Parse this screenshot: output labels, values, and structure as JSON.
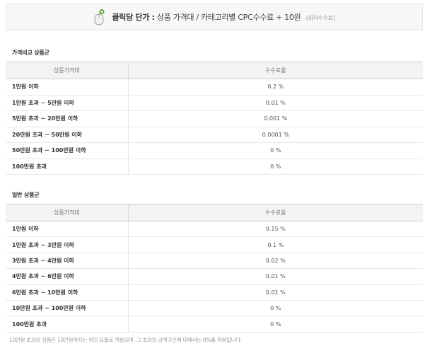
{
  "banner": {
    "label": "클릭당 단가 :",
    "formula": "상품 가격대 / 카테고리별 CPC수수료 + 10원",
    "note": "(최저수수료)",
    "icon": "mouse-icon",
    "accent": "#6cb33f"
  },
  "tables": [
    {
      "title": "가격비교 상품군",
      "headers": [
        "상품가격대",
        "수수료율"
      ],
      "rows": [
        {
          "range": "1만원 이하",
          "rate": "0.2 %"
        },
        {
          "range": "1만원 초과 ~ 5만원 이하",
          "rate": "0.01 %"
        },
        {
          "range": "5만원 초과 ~ 20만원 이하",
          "rate": "0.001 %"
        },
        {
          "range": "20만원 초과 ~ 50만원 이하",
          "rate": "0.0001 %"
        },
        {
          "range": "50만원 초과 ~ 100만원 이하",
          "rate": "0 %"
        },
        {
          "range": "100만원 초과",
          "rate": "0 %"
        }
      ]
    },
    {
      "title": "일반 상품군",
      "headers": [
        "상품가격대",
        "수수료율"
      ],
      "rows": [
        {
          "range": "1만원 이하",
          "rate": "0.15 %"
        },
        {
          "range": "1만원 초과 ~ 3만원 이하",
          "rate": "0.1 %"
        },
        {
          "range": "3만원 초과 ~ 4만원 이하",
          "rate": "0.02 %"
        },
        {
          "range": "4만원 초과 ~ 6만원 이하",
          "rate": "0.01 %"
        },
        {
          "range": "6만원 초과 ~ 10만원 이하",
          "rate": "0.01 %"
        },
        {
          "range": "10만원 초과 ~ 100만원 이하",
          "rate": "0 %"
        },
        {
          "range": "100만원 초과",
          "rate": "0 %"
        }
      ]
    }
  ],
  "footnote": "10만원 초과의 상품은 10만원까지는 위의 요율로 적용되며, 그 초과의 금액구간에 대해서는 0%를 적용합니다."
}
